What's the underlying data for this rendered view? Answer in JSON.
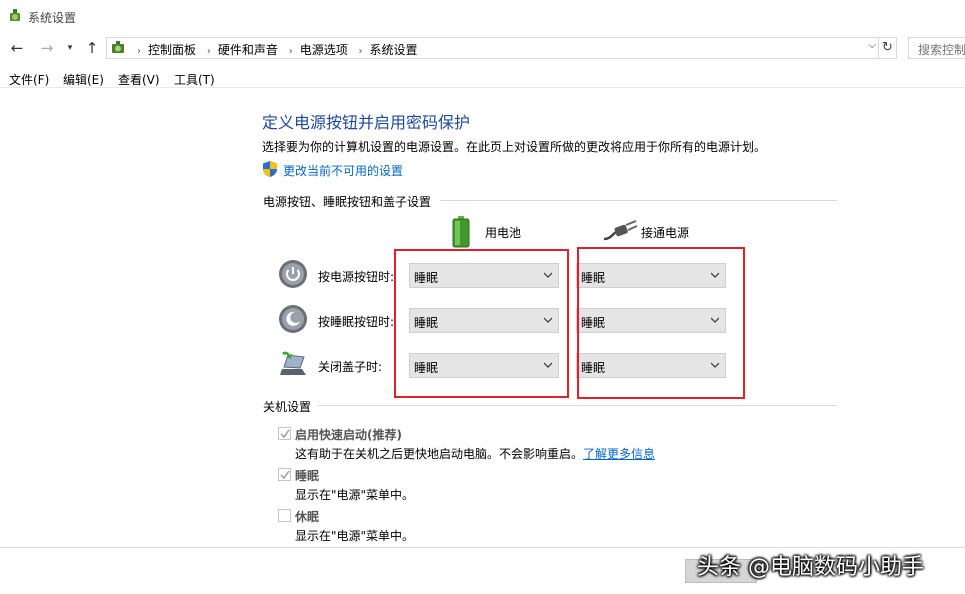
{
  "window": {
    "title": "系统设置"
  },
  "address": {
    "breadcrumbs": [
      "控制面板",
      "硬件和声音",
      "电源选项",
      "系统设置"
    ],
    "search_placeholder": "搜索控制"
  },
  "menu": [
    "文件(F)",
    "编辑(E)",
    "查看(V)",
    "工具(T)"
  ],
  "page": {
    "heading": "定义电源按钮并启用密码保护",
    "description": "选择要为你的计算机设置的电源设置。在此页上对设置所做的更改将应用于你所有的电源计划。",
    "change_link": "更改当前不可用的设置"
  },
  "buttons_section": {
    "title": "电源按钮、睡眠按钮和盖子设置",
    "col_battery": "用电池",
    "col_plugged": "接通电源",
    "rows": [
      {
        "label": "按电源按钮时:",
        "icon": "power-button-icon",
        "battery": "睡眠",
        "plugged": "睡眠"
      },
      {
        "label": "按睡眠按钮时:",
        "icon": "sleep-button-icon",
        "battery": "睡眠",
        "plugged": "睡眠"
      },
      {
        "label": "关闭盖子时:",
        "icon": "laptop-lid-icon",
        "battery": "睡眠",
        "plugged": "睡眠"
      }
    ]
  },
  "shutdown_section": {
    "title": "关机设置",
    "options": [
      {
        "label": "启用快速启动(推荐)",
        "checked": true,
        "disabled": true,
        "desc": "这有助于在关机之后更快地启动电脑。不会影响重启。",
        "link": "了解更多信息"
      },
      {
        "label": "睡眠",
        "checked": true,
        "disabled": true,
        "desc": "显示在\"电源\"菜单中。"
      },
      {
        "label": "休眠",
        "checked": false,
        "disabled": true,
        "desc": "显示在\"电源\"菜单中。"
      }
    ]
  },
  "watermark": "头条 @电脑数码小助手",
  "colors": {
    "heading": "#1e4aa3",
    "link": "#0066cc",
    "highlight_box": "#e0202a"
  }
}
